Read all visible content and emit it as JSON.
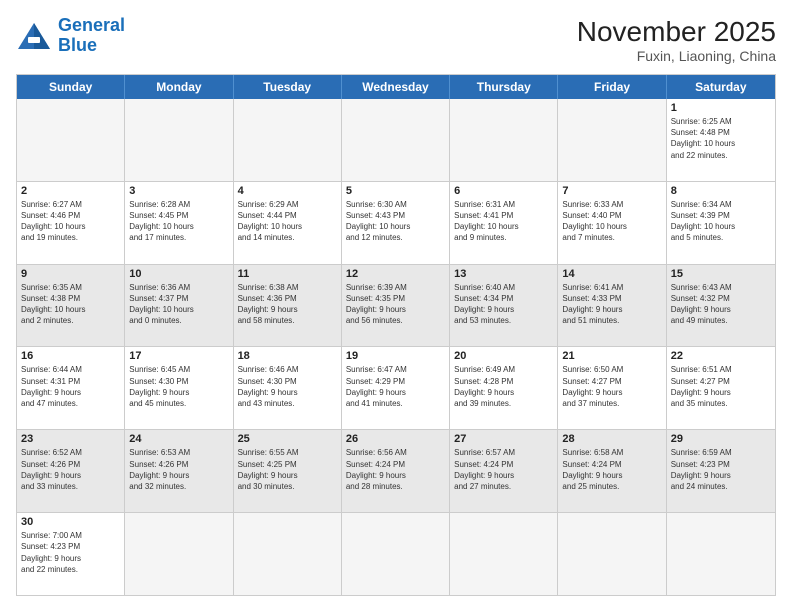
{
  "logo": {
    "text_general": "General",
    "text_blue": "Blue"
  },
  "title": "November 2025",
  "subtitle": "Fuxin, Liaoning, China",
  "header_days": [
    "Sunday",
    "Monday",
    "Tuesday",
    "Wednesday",
    "Thursday",
    "Friday",
    "Saturday"
  ],
  "weeks": [
    [
      {
        "day": "",
        "empty": true
      },
      {
        "day": "",
        "empty": true
      },
      {
        "day": "",
        "empty": true
      },
      {
        "day": "",
        "empty": true
      },
      {
        "day": "",
        "empty": true
      },
      {
        "day": "",
        "empty": true
      },
      {
        "day": "1",
        "info": "Sunrise: 6:25 AM\nSunset: 4:48 PM\nDaylight: 10 hours\nand 22 minutes."
      }
    ],
    [
      {
        "day": "2",
        "info": "Sunrise: 6:27 AM\nSunset: 4:46 PM\nDaylight: 10 hours\nand 19 minutes."
      },
      {
        "day": "3",
        "info": "Sunrise: 6:28 AM\nSunset: 4:45 PM\nDaylight: 10 hours\nand 17 minutes."
      },
      {
        "day": "4",
        "info": "Sunrise: 6:29 AM\nSunset: 4:44 PM\nDaylight: 10 hours\nand 14 minutes."
      },
      {
        "day": "5",
        "info": "Sunrise: 6:30 AM\nSunset: 4:43 PM\nDaylight: 10 hours\nand 12 minutes."
      },
      {
        "day": "6",
        "info": "Sunrise: 6:31 AM\nSunset: 4:41 PM\nDaylight: 10 hours\nand 9 minutes."
      },
      {
        "day": "7",
        "info": "Sunrise: 6:33 AM\nSunset: 4:40 PM\nDaylight: 10 hours\nand 7 minutes."
      },
      {
        "day": "8",
        "info": "Sunrise: 6:34 AM\nSunset: 4:39 PM\nDaylight: 10 hours\nand 5 minutes."
      }
    ],
    [
      {
        "day": "9",
        "info": "Sunrise: 6:35 AM\nSunset: 4:38 PM\nDaylight: 10 hours\nand 2 minutes.",
        "shaded": true
      },
      {
        "day": "10",
        "info": "Sunrise: 6:36 AM\nSunset: 4:37 PM\nDaylight: 10 hours\nand 0 minutes.",
        "shaded": true
      },
      {
        "day": "11",
        "info": "Sunrise: 6:38 AM\nSunset: 4:36 PM\nDaylight: 9 hours\nand 58 minutes.",
        "shaded": true
      },
      {
        "day": "12",
        "info": "Sunrise: 6:39 AM\nSunset: 4:35 PM\nDaylight: 9 hours\nand 56 minutes.",
        "shaded": true
      },
      {
        "day": "13",
        "info": "Sunrise: 6:40 AM\nSunset: 4:34 PM\nDaylight: 9 hours\nand 53 minutes.",
        "shaded": true
      },
      {
        "day": "14",
        "info": "Sunrise: 6:41 AM\nSunset: 4:33 PM\nDaylight: 9 hours\nand 51 minutes.",
        "shaded": true
      },
      {
        "day": "15",
        "info": "Sunrise: 6:43 AM\nSunset: 4:32 PM\nDaylight: 9 hours\nand 49 minutes.",
        "shaded": true
      }
    ],
    [
      {
        "day": "16",
        "info": "Sunrise: 6:44 AM\nSunset: 4:31 PM\nDaylight: 9 hours\nand 47 minutes."
      },
      {
        "day": "17",
        "info": "Sunrise: 6:45 AM\nSunset: 4:30 PM\nDaylight: 9 hours\nand 45 minutes."
      },
      {
        "day": "18",
        "info": "Sunrise: 6:46 AM\nSunset: 4:30 PM\nDaylight: 9 hours\nand 43 minutes."
      },
      {
        "day": "19",
        "info": "Sunrise: 6:47 AM\nSunset: 4:29 PM\nDaylight: 9 hours\nand 41 minutes."
      },
      {
        "day": "20",
        "info": "Sunrise: 6:49 AM\nSunset: 4:28 PM\nDaylight: 9 hours\nand 39 minutes."
      },
      {
        "day": "21",
        "info": "Sunrise: 6:50 AM\nSunset: 4:27 PM\nDaylight: 9 hours\nand 37 minutes."
      },
      {
        "day": "22",
        "info": "Sunrise: 6:51 AM\nSunset: 4:27 PM\nDaylight: 9 hours\nand 35 minutes."
      }
    ],
    [
      {
        "day": "23",
        "info": "Sunrise: 6:52 AM\nSunset: 4:26 PM\nDaylight: 9 hours\nand 33 minutes.",
        "shaded": true
      },
      {
        "day": "24",
        "info": "Sunrise: 6:53 AM\nSunset: 4:26 PM\nDaylight: 9 hours\nand 32 minutes.",
        "shaded": true
      },
      {
        "day": "25",
        "info": "Sunrise: 6:55 AM\nSunset: 4:25 PM\nDaylight: 9 hours\nand 30 minutes.",
        "shaded": true
      },
      {
        "day": "26",
        "info": "Sunrise: 6:56 AM\nSunset: 4:24 PM\nDaylight: 9 hours\nand 28 minutes.",
        "shaded": true
      },
      {
        "day": "27",
        "info": "Sunrise: 6:57 AM\nSunset: 4:24 PM\nDaylight: 9 hours\nand 27 minutes.",
        "shaded": true
      },
      {
        "day": "28",
        "info": "Sunrise: 6:58 AM\nSunset: 4:24 PM\nDaylight: 9 hours\nand 25 minutes.",
        "shaded": true
      },
      {
        "day": "29",
        "info": "Sunrise: 6:59 AM\nSunset: 4:23 PM\nDaylight: 9 hours\nand 24 minutes.",
        "shaded": true
      }
    ],
    [
      {
        "day": "30",
        "info": "Sunrise: 7:00 AM\nSunset: 4:23 PM\nDaylight: 9 hours\nand 22 minutes."
      },
      {
        "day": "",
        "empty": true
      },
      {
        "day": "",
        "empty": true
      },
      {
        "day": "",
        "empty": true
      },
      {
        "day": "",
        "empty": true
      },
      {
        "day": "",
        "empty": true
      },
      {
        "day": "",
        "empty": true
      }
    ]
  ]
}
